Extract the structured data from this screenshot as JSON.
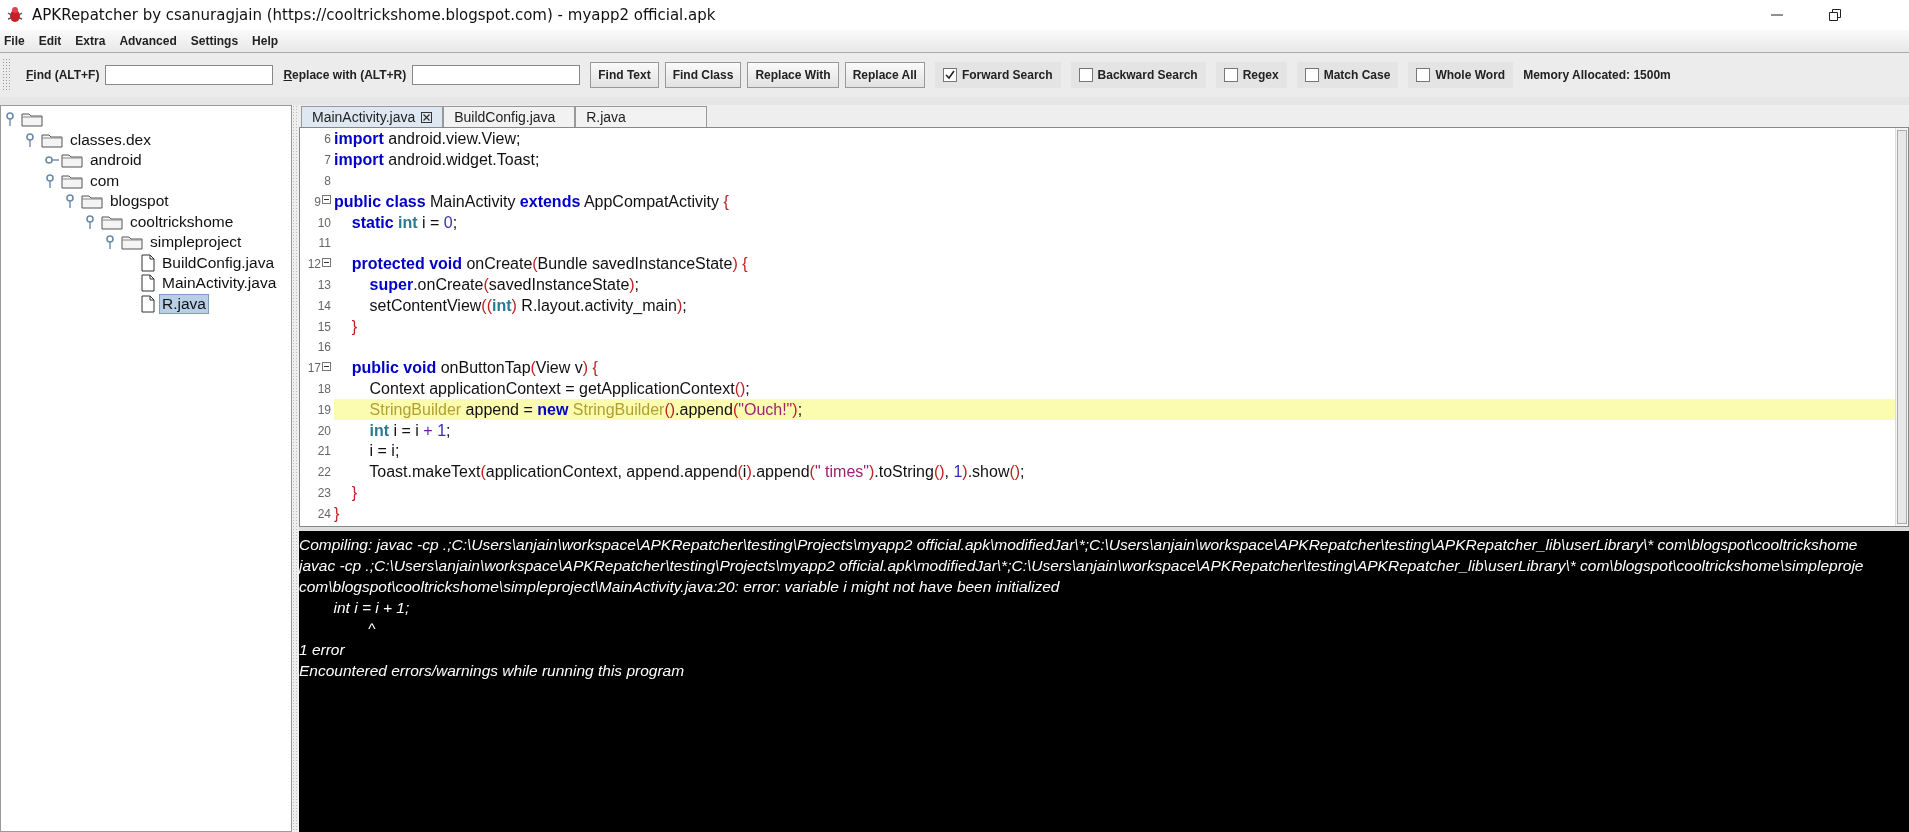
{
  "window": {
    "title": "APKRepatcher by csanuragjain (https://cooltrickshome.blogspot.com) - myapp2 official.apk"
  },
  "menu": [
    "File",
    "Edit",
    "Extra",
    "Advanced",
    "Settings",
    "Help"
  ],
  "toolbar": {
    "find_label": "Find (ALT+F)",
    "replace_label": "Replace with (ALT+R)",
    "buttons": [
      "Find Text",
      "Find Class",
      "Replace With",
      "Replace All"
    ],
    "options": [
      {
        "label": "Forward Search",
        "checked": true
      },
      {
        "label": "Backward Search",
        "checked": false
      },
      {
        "label": "Regex",
        "checked": false
      },
      {
        "label": "Match Case",
        "checked": false
      },
      {
        "label": "Whole Word",
        "checked": false
      }
    ],
    "memory": "Memory Allocated: 1500m"
  },
  "tree": {
    "kind": "folder",
    "expanded": true,
    "children": [
      {
        "kind": "folder",
        "label": "classes.dex",
        "selected": false,
        "expanded": true,
        "children": [
          {
            "kind": "folder",
            "label": "android",
            "selected": false,
            "expanded": false
          },
          {
            "kind": "folder",
            "label": "com",
            "selected": false,
            "expanded": true,
            "children": [
              {
                "kind": "folder",
                "label": "blogspot",
                "selected": false,
                "expanded": true,
                "children": [
                  {
                    "kind": "folder",
                    "label": "cooltrickshome",
                    "selected": false,
                    "expanded": true,
                    "children": [
                      {
                        "kind": "folder",
                        "label": "simpleproject",
                        "selected": false,
                        "expanded": true,
                        "children": [
                          {
                            "kind": "file",
                            "label": "BuildConfig.java",
                            "selected": false
                          },
                          {
                            "kind": "file",
                            "label": "MainActivity.java",
                            "selected": false
                          },
                          {
                            "kind": "file",
                            "label": "R.java",
                            "selected": true
                          }
                        ]
                      }
                    ]
                  }
                ]
              }
            ]
          }
        ]
      }
    ]
  },
  "tabs": [
    {
      "label": "MainActivity.java",
      "selected": true
    },
    {
      "label": "BuildConfig.java",
      "selected": false
    },
    {
      "label": "R.java",
      "selected": false
    }
  ],
  "code": [
    {
      "number": "6",
      "fold": false,
      "highlighted": false,
      "tokens": [
        {
          "kind": "kw",
          "text": "import"
        },
        {
          "kind": "plain",
          "text": " android.view.View;"
        }
      ]
    },
    {
      "number": "7",
      "fold": false,
      "highlighted": false,
      "tokens": [
        {
          "kind": "kw",
          "text": "import"
        },
        {
          "kind": "plain",
          "text": " android.widget.Toast;"
        }
      ]
    },
    {
      "number": "8",
      "fold": false,
      "highlighted": false
    },
    {
      "number": "9",
      "fold": true,
      "highlighted": false,
      "tokens": [
        {
          "kind": "kw",
          "text": "public class"
        },
        {
          "kind": "plain",
          "text": " MainActivity "
        },
        {
          "kind": "kw",
          "text": "extends"
        },
        {
          "kind": "plain",
          "text": " AppCompatActivity "
        },
        {
          "kind": "paren",
          "text": "{"
        }
      ]
    },
    {
      "number": "10",
      "fold": false,
      "highlighted": false,
      "tokens": [
        {
          "kind": "kw",
          "text": "    static "
        },
        {
          "kind": "type",
          "text": "int"
        },
        {
          "kind": "plain",
          "text": " i = "
        },
        {
          "kind": "num",
          "text": "0"
        },
        {
          "kind": "plain",
          "text": ";"
        }
      ]
    },
    {
      "number": "11",
      "fold": false,
      "highlighted": false
    },
    {
      "number": "12",
      "fold": true,
      "highlighted": false,
      "tokens": [
        {
          "kind": "kw",
          "text": "    protected void"
        },
        {
          "kind": "plain",
          "text": " onCreate"
        },
        {
          "kind": "paren",
          "text": "("
        },
        {
          "kind": "plain",
          "text": "Bundle savedInstanceState"
        },
        {
          "kind": "paren",
          "text": ") {"
        }
      ]
    },
    {
      "number": "13",
      "fold": false,
      "highlighted": false,
      "tokens": [
        {
          "kind": "kw",
          "text": "        super"
        },
        {
          "kind": "plain",
          "text": ".onCreate"
        },
        {
          "kind": "paren",
          "text": "("
        },
        {
          "kind": "plain",
          "text": "savedInstanceState"
        },
        {
          "kind": "paren",
          "text": ")"
        },
        {
          "kind": "plain",
          "text": ";"
        }
      ]
    },
    {
      "number": "14",
      "fold": false,
      "highlighted": false,
      "tokens": [
        {
          "kind": "plain",
          "text": "        setContentView"
        },
        {
          "kind": "paren",
          "text": "(("
        },
        {
          "kind": "type",
          "text": "int"
        },
        {
          "kind": "paren",
          "text": ")"
        },
        {
          "kind": "plain",
          "text": " R.layout.activity_main"
        },
        {
          "kind": "paren",
          "text": ")"
        },
        {
          "kind": "plain",
          "text": ";"
        }
      ]
    },
    {
      "number": "15",
      "fold": false,
      "highlighted": false,
      "tokens": [
        {
          "kind": "paren",
          "text": "    }"
        }
      ]
    },
    {
      "number": "16",
      "fold": false,
      "highlighted": false
    },
    {
      "number": "17",
      "fold": true,
      "highlighted": false,
      "tokens": [
        {
          "kind": "kw",
          "text": "    public void"
        },
        {
          "kind": "plain",
          "text": " onButtonTap"
        },
        {
          "kind": "paren",
          "text": "("
        },
        {
          "kind": "plain",
          "text": "View v"
        },
        {
          "kind": "paren",
          "text": ") {"
        }
      ]
    },
    {
      "number": "18",
      "fold": false,
      "highlighted": false,
      "tokens": [
        {
          "kind": "plain",
          "text": "        Context applicationContext = getApplicationContext"
        },
        {
          "kind": "paren",
          "text": "()"
        },
        {
          "kind": "plain",
          "text": ";"
        }
      ]
    },
    {
      "number": "19",
      "fold": false,
      "highlighted": true,
      "tokens": [
        {
          "kind": "cls",
          "text": "        StringBuilder"
        },
        {
          "kind": "plain",
          "text": " append = "
        },
        {
          "kind": "kw",
          "text": "new "
        },
        {
          "kind": "cls",
          "text": "StringBuilder"
        },
        {
          "kind": "paren",
          "text": "()"
        },
        {
          "kind": "plain",
          "text": ".append"
        },
        {
          "kind": "paren",
          "text": "("
        },
        {
          "kind": "str",
          "text": "\"Ouch!\""
        },
        {
          "kind": "paren",
          "text": ")"
        },
        {
          "kind": "plain",
          "text": ";"
        }
      ]
    },
    {
      "number": "20",
      "fold": false,
      "highlighted": false,
      "tokens": [
        {
          "kind": "type",
          "text": "        int"
        },
        {
          "kind": "plain",
          "text": " i = i "
        },
        {
          "kind": "op",
          "text": "+ "
        },
        {
          "kind": "num",
          "text": "1"
        },
        {
          "kind": "plain",
          "text": ";"
        }
      ]
    },
    {
      "number": "21",
      "fold": false,
      "highlighted": false,
      "tokens": [
        {
          "kind": "plain",
          "text": "        i = i;"
        }
      ]
    },
    {
      "number": "22",
      "fold": false,
      "highlighted": false,
      "tokens": [
        {
          "kind": "plain",
          "text": "        Toast.makeText"
        },
        {
          "kind": "paren",
          "text": "("
        },
        {
          "kind": "plain",
          "text": "applicationContext, append.append"
        },
        {
          "kind": "paren",
          "text": "("
        },
        {
          "kind": "plain",
          "text": "i"
        },
        {
          "kind": "paren",
          "text": ")"
        },
        {
          "kind": "plain",
          "text": ".append"
        },
        {
          "kind": "paren",
          "text": "("
        },
        {
          "kind": "str",
          "text": "\" times\""
        },
        {
          "kind": "paren",
          "text": ")"
        },
        {
          "kind": "plain",
          "text": ".toString"
        },
        {
          "kind": "paren",
          "text": "()"
        },
        {
          "kind": "plain",
          "text": ", "
        },
        {
          "kind": "num",
          "text": "1"
        },
        {
          "kind": "paren",
          "text": ")"
        },
        {
          "kind": "plain",
          "text": ".show"
        },
        {
          "kind": "paren",
          "text": "()"
        },
        {
          "kind": "plain",
          "text": ";"
        }
      ]
    },
    {
      "number": "23",
      "fold": false,
      "highlighted": false,
      "tokens": [
        {
          "kind": "paren",
          "text": "    }"
        }
      ]
    },
    {
      "number": "24",
      "fold": false,
      "highlighted": false,
      "tokens": [
        {
          "kind": "paren",
          "text": "}"
        }
      ]
    }
  ],
  "console": [
    "Compiling: javac -cp .;C:\\Users\\anjain\\workspace\\APKRepatcher\\testing\\Projects\\myapp2 official.apk\\modifiedJar\\*;C:\\Users\\anjain\\workspace\\APKRepatcher\\testing\\APKRepatcher_lib\\userLibrary\\* com\\blogspot\\cooltrickshome",
    "javac -cp .;C:\\Users\\anjain\\workspace\\APKRepatcher\\testing\\Projects\\myapp2 official.apk\\modifiedJar\\*;C:\\Users\\anjain\\workspace\\APKRepatcher\\testing\\APKRepatcher_lib\\userLibrary\\* com\\blogspot\\cooltrickshome\\simpleproje",
    "com\\blogspot\\cooltrickshome\\simpleproject\\MainActivity.java:20: error: variable i might not have been initialized",
    "        int i = i + 1;",
    "                ^",
    "1 error",
    "Encountered errors/warnings while running this program"
  ]
}
